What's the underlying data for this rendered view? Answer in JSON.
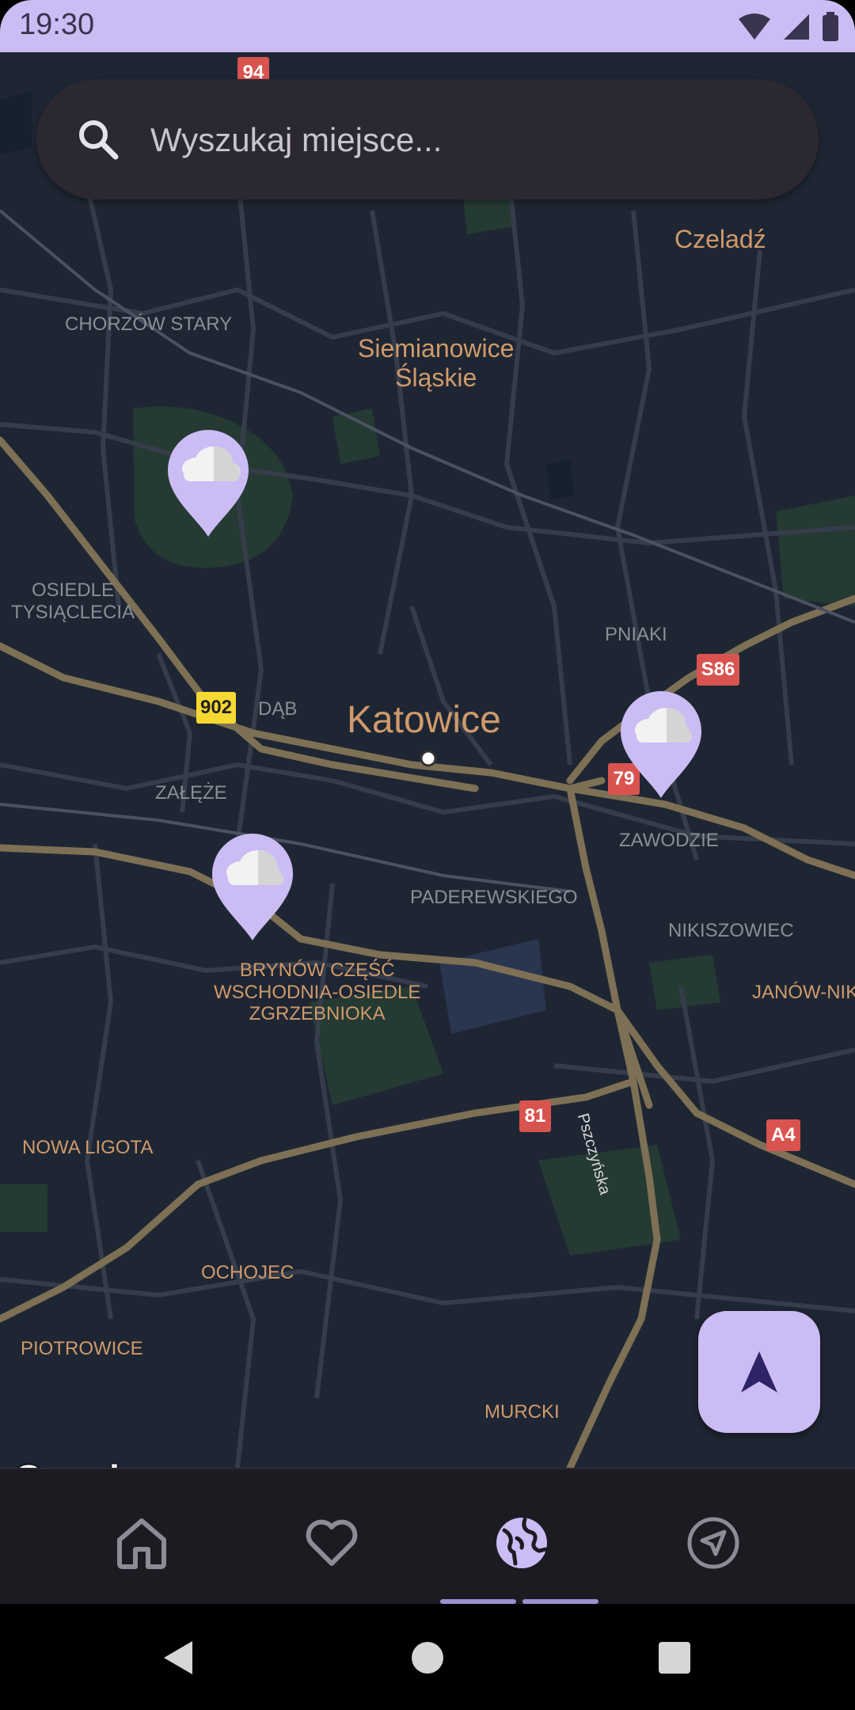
{
  "status_bar": {
    "time": "19:30"
  },
  "search": {
    "placeholder": "Wyszukaj miejsce..."
  },
  "map": {
    "labels": {
      "czeladz": "Czeladź",
      "siemianowice": "Siemianowice\nŚląskie",
      "chorzow_stary": "CHORZÓW STARY",
      "osiedle_tysiaclecia": "OSIEDLE\nTYSIĄCLECIA",
      "pniaki": "PNIAKI",
      "dab": "DĄB",
      "katowice": "Katowice",
      "zaleze": "ZAŁĘŻE",
      "zawodzie": "ZAWODZIE",
      "paderewskiego": "PADEREWSKIEGO",
      "nikiszowiec": "NIKISZOWIEC",
      "brynow": "BRYNÓW CZĘŚĆ\nWSCHODNIA-OSIEDLE\nZGRZEBNIOKA",
      "janow": "JANÓW-NIK",
      "pszczynska": "Pszczyńska",
      "nowa_ligota": "NOWA LIGOTA",
      "ochojec": "OCHOJEC",
      "piotrowice": "PIOTROWICE",
      "murcki": "MURCKI"
    },
    "road_shields": {
      "r94": "94",
      "r902": "902",
      "s86": "S86",
      "r79": "79",
      "r81": "81",
      "a4": "A4"
    },
    "attribution": "Google",
    "pins": [
      {
        "icon": "cloud-icon"
      },
      {
        "icon": "cloud-icon"
      },
      {
        "icon": "cloud-icon"
      }
    ]
  },
  "fab": {
    "icon": "navigation-arrow-icon"
  },
  "bottom_nav": {
    "items": [
      {
        "icon": "home-icon"
      },
      {
        "icon": "heart-icon"
      },
      {
        "icon": "globe-icon",
        "active": true
      },
      {
        "icon": "send-icon"
      }
    ]
  },
  "colors": {
    "accent": "#cbbcf4",
    "map_background": "#1f2633",
    "road": "#8a7c5f",
    "label": "#cf9a6b"
  }
}
